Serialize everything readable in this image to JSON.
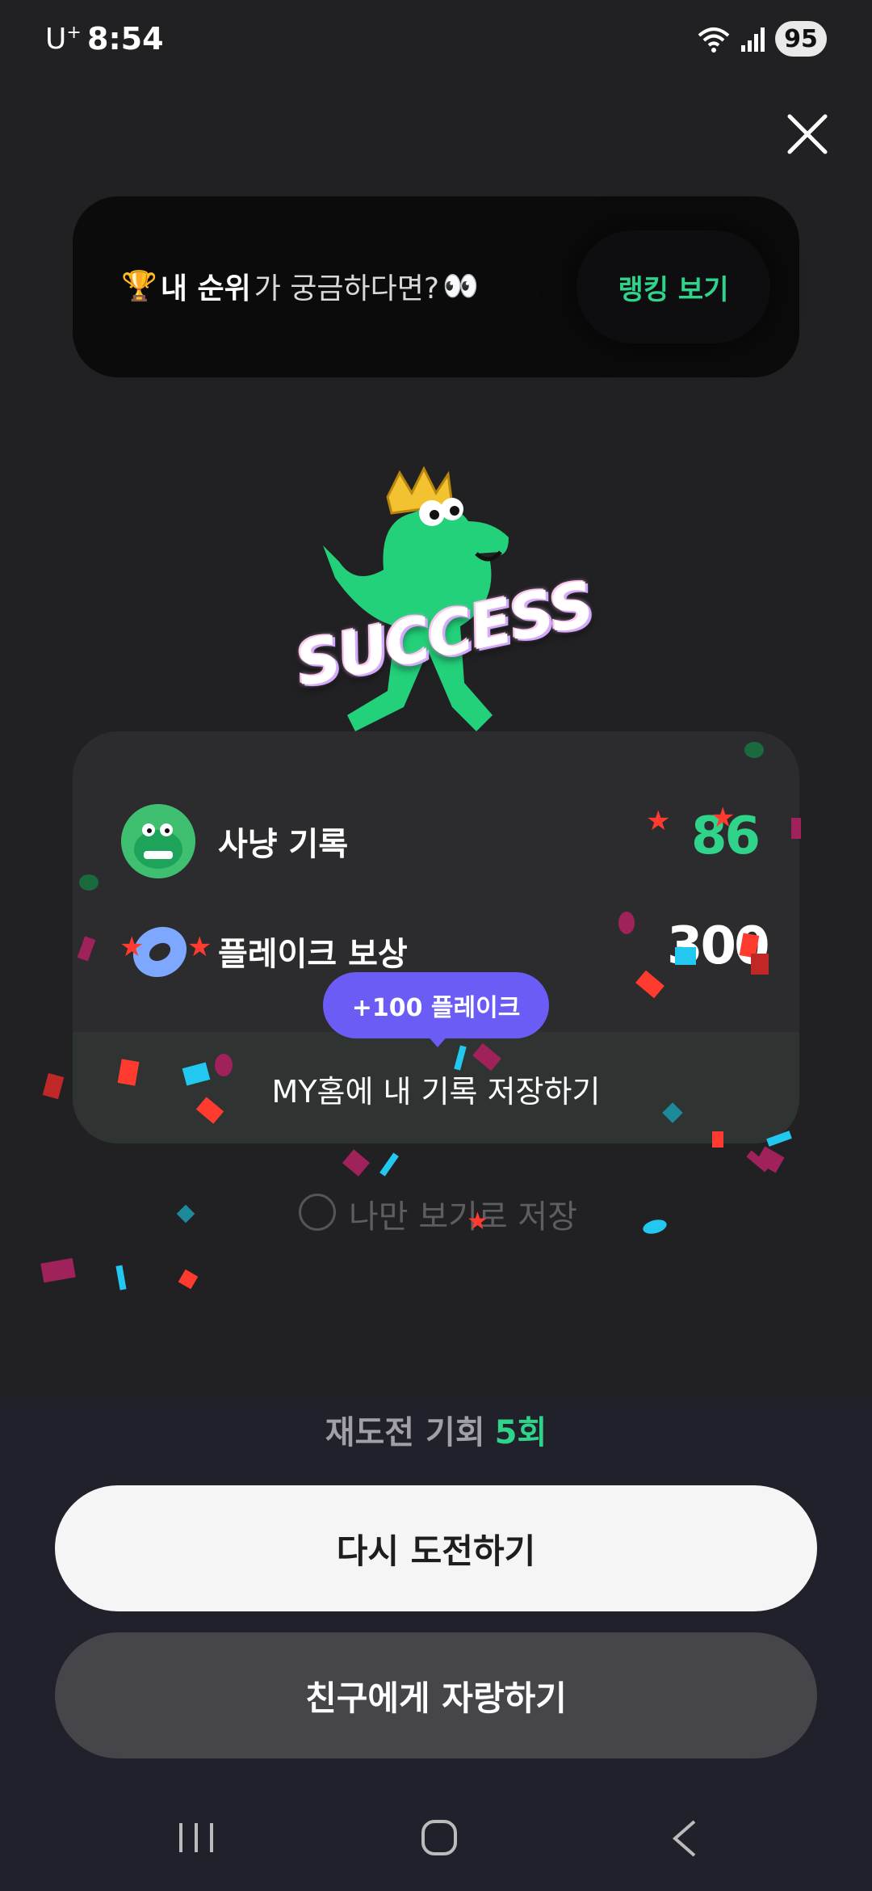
{
  "status_bar": {
    "carrier": "U",
    "carrier_sup": "+",
    "time": "8:54",
    "battery": "95"
  },
  "rank_banner": {
    "trophy": "🏆",
    "highlight": "내 순위",
    "text": "가 궁금하다면?",
    "eyes": "👀",
    "button_label": "랭킹 보기"
  },
  "mascot": {
    "badge_text": "SUCCESS"
  },
  "result": {
    "rows": [
      {
        "label": "사냥 기록",
        "value": "86",
        "value_color": "#2fd48a",
        "icon": "dinosaur-avatar-icon"
      },
      {
        "label": "플레이크 보상",
        "value": "300",
        "value_color": "#ffffff",
        "icon": "flake-ring-icon"
      }
    ],
    "tooltip": "+100 플레이크",
    "save_label": "MY홈에 내 기록 저장하기",
    "private_label": "나만 보기로 저장"
  },
  "retry": {
    "label": "재도전 기회",
    "count": "5회"
  },
  "buttons": {
    "retry": "다시 도전하기",
    "share": "친구에게 자랑하기"
  },
  "colors": {
    "accent_green": "#2fd48a",
    "tooltip_purple": "#6a5cf4",
    "background": "#212124"
  }
}
